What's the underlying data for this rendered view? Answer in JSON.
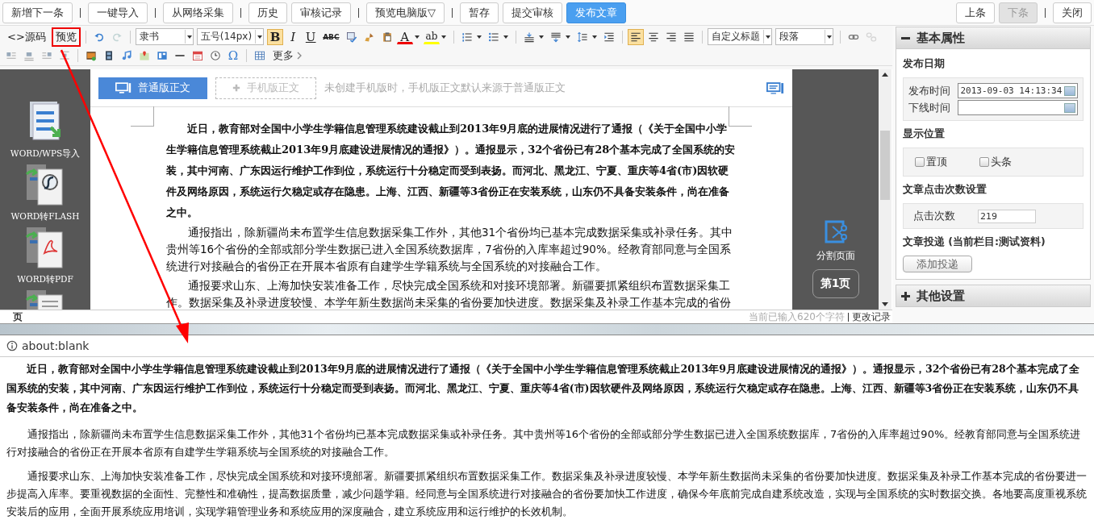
{
  "top_bar": {
    "left": [
      {
        "kind": "button",
        "label": "新增下一条",
        "disabled": false
      },
      {
        "kind": "sep"
      },
      {
        "kind": "button",
        "label": "一键导入",
        "disabled": false
      },
      {
        "kind": "sep"
      },
      {
        "kind": "button",
        "label": "从网络采集",
        "disabled": false
      },
      {
        "kind": "sep"
      },
      {
        "kind": "button",
        "label": "历史",
        "disabled": false
      },
      {
        "kind": "button",
        "label": "审核记录",
        "disabled": false
      },
      {
        "kind": "sep"
      },
      {
        "kind": "button",
        "label": "预览电脑版▽",
        "disabled": false
      },
      {
        "kind": "sep"
      },
      {
        "kind": "button",
        "label": "暂存",
        "disabled": false
      },
      {
        "kind": "button",
        "label": "提交审核",
        "disabled": false
      },
      {
        "kind": "primary",
        "label": "发布文章",
        "disabled": false
      }
    ],
    "right": [
      {
        "kind": "button",
        "label": "上条",
        "disabled": false
      },
      {
        "kind": "button",
        "label": "下条",
        "disabled": true
      },
      {
        "kind": "sep"
      },
      {
        "kind": "button",
        "label": "关闭",
        "disabled": false
      }
    ]
  },
  "toolbar": {
    "row1": [
      {
        "kind": "text",
        "label": "<>源码",
        "highlighted": false
      },
      {
        "kind": "text",
        "label": "预览",
        "highlighted": true
      },
      {
        "kind": "sep"
      },
      {
        "kind": "undo",
        "disabled": false
      },
      {
        "kind": "redo",
        "disabled": true
      },
      {
        "kind": "sep"
      },
      {
        "kind": "select",
        "value": "隶书"
      },
      {
        "kind": "select",
        "value": "五号(14px)"
      },
      {
        "kind": "bold",
        "label": "B",
        "selected": true
      },
      {
        "kind": "italic",
        "label": "I",
        "selected": false
      },
      {
        "kind": "underline",
        "label": "U",
        "selected": false
      },
      {
        "kind": "strike",
        "label": "ABC",
        "selected": false
      },
      {
        "kind": "spell"
      },
      {
        "kind": "brush"
      },
      {
        "kind": "paste"
      },
      {
        "kind": "fontcolor",
        "label": "A"
      },
      {
        "kind": "highlight",
        "label": "ab"
      },
      {
        "kind": "sep"
      },
      {
        "kind": "olist"
      },
      {
        "kind": "ulist"
      },
      {
        "kind": "sep"
      },
      {
        "kind": "space-top"
      },
      {
        "kind": "space-bottom"
      },
      {
        "kind": "line-height"
      },
      {
        "kind": "indent"
      },
      {
        "kind": "sep"
      },
      {
        "kind": "align-left",
        "selected": true
      },
      {
        "kind": "align-center",
        "selected": false
      },
      {
        "kind": "align-right",
        "selected": false
      },
      {
        "kind": "justify",
        "selected": false
      },
      {
        "kind": "sep"
      },
      {
        "kind": "select",
        "value": "自定义标题"
      },
      {
        "kind": "select",
        "value": "段落"
      },
      {
        "kind": "sep"
      },
      {
        "kind": "link",
        "disabled": false
      },
      {
        "kind": "unlink",
        "disabled": true
      }
    ],
    "row2": [
      {
        "kind": "float-left"
      },
      {
        "kind": "float-none"
      },
      {
        "kind": "float-right"
      },
      {
        "kind": "float-center"
      },
      {
        "kind": "sep"
      },
      {
        "kind": "image"
      },
      {
        "kind": "video"
      },
      {
        "kind": "music"
      },
      {
        "kind": "map"
      },
      {
        "kind": "template"
      },
      {
        "kind": "hr"
      },
      {
        "kind": "date"
      },
      {
        "kind": "time"
      },
      {
        "kind": "symbol",
        "label": "Ω"
      },
      {
        "kind": "sep"
      },
      {
        "kind": "table"
      },
      {
        "kind": "more",
        "label": "更多"
      }
    ]
  },
  "tools_panel": [
    {
      "kind": "wps",
      "label": "WORD/WPS导入"
    },
    {
      "kind": "flash",
      "label": "WORD转FLASH"
    },
    {
      "kind": "pdf",
      "label": "WORD转PDF"
    },
    {
      "kind": "doc"
    }
  ],
  "editor_tabs": [
    {
      "label": "普通版正文",
      "selected": true
    },
    {
      "label": "手机版正文",
      "selected": false
    }
  ],
  "editor_hint": "未创建手机版时，手机版正文默认来源于普通版正文",
  "content": [
    {
      "kind": "lishu",
      "text": "近日，教育部对全国中小学生学籍信息管理系统建设截止到2013年9月底的进展情况进行了通报（《关于全国中小学生学籍信息管理系统截止2013年9月底建设进展情况的通报》）。通报显示，32个省份已有28个基本完成了全国系统的安装，其中河南、广东因运行维护工作到位，系统运行十分稳定而受到表扬。而河北、黑龙江、宁夏、重庆等4省(市)因软硬件及网络原因，系统运行欠稳定或存在隐患。上海、江西、新疆等3省份正在安装系统，山东仍不具备安装条件，尚在准备之中。"
    },
    {
      "kind": "plain",
      "text": "通报指出，除新疆尚未布置学生信息数据采集工作外，其他31个省份均已基本完成数据采集或补录任务。其中贵州等16个省份的全部或部分学生数据已进入全国系统数据库，7省份的入库率超过90%。经教育部同意与全国系统进行对接融合的省份正在开展本省原有自建学生学籍系统与全国系统的对接融合工作。"
    },
    {
      "kind": "plain",
      "text": "通报要求山东、上海加快安装准备工作，尽快完成全国系统和对接环境部署。新疆要抓紧组织布置数据采集工作。数据采集及补录进度较慢、本学年新生数据尚未采集的省份要加快进度。数据采集及补录工作基本完成的省份"
    }
  ],
  "page_tools": {
    "split_label": "分割页面",
    "page_button": "第1页"
  },
  "status_bar": {
    "left": "页",
    "count": "当前已输入620个字符",
    "history_link": "更改记录"
  },
  "side_panel": [
    {
      "title": "基本属性",
      "expanded": true
    },
    {
      "title": "其他设置",
      "expanded": false
    }
  ],
  "basic": {
    "date_heading": "发布日期",
    "publish_label": "发布时间",
    "publish_value": "2013-09-03 14:13:34",
    "offline_label": "下线时间",
    "position_heading": "显示位置",
    "positions": [
      {
        "label": "置顶",
        "checked": false
      },
      {
        "label": "头条",
        "checked": false
      }
    ],
    "clicks_heading": "文章点击次数设置",
    "clicks_label": "点击次数",
    "clicks_value": "219",
    "delivery_heading": "文章投递 (当前栏目:测试资料)",
    "delivery_button": "添加投递"
  },
  "preview_window": {
    "address": "about:blank",
    "paragraphs": [
      {
        "kind": "lishu",
        "text": "近日，教育部对全国中小学生学籍信息管理系统建设截止到2013年9月底的进展情况进行了通报（《关于全国中小学生学籍信息管理系统截止2013年9月底建设进展情况的通报》）。通报显示，32个省份已有28个基本完成了全国系统的安装，其中河南、广东因运行维护工作到位，系统运行十分稳定而受到表扬。而河北、黑龙江、宁夏、重庆等4省(市)因软硬件及网络原因，系统运行欠稳定或存在隐患。上海、江西、新疆等3省份正在安装系统，山东仍不具备安装条件，尚在准备之中。"
      },
      {
        "kind": "plain",
        "text": "通报指出，除新疆尚未布置学生信息数据采集工作外，其他31个省份均已基本完成数据采集或补录任务。其中贵州等16个省份的全部或部分学生数据已进入全国系统数据库，7省份的入库率超过90%。经教育部同意与全国系统进行对接融合的省份正在开展本省原有自建学生学籍系统与全国系统的对接融合工作。"
      },
      {
        "kind": "plain",
        "text": "通报要求山东、上海加快安装准备工作，尽快完成全国系统和对接环境部署。新疆要抓紧组织布置数据采集工作。数据采集及补录进度较慢、本学年新生数据尚未采集的省份要加快进度。数据采集及补录工作基本完成的省份要进一步提高入库率。要重视数据的全面性、完整性和准确性，提高数据质量，减少问题学籍。经同意与全国系统进行对接融合的省份要加快工作进度，确保今年底前完成自建系统改造，实现与全国系统的实时数据交换。各地要高度重视系统安装后的应用，全面开展系统应用培训，实现学籍管理业务和系统应用的深度融合，建立系统应用和运行维护的长效机制。"
      }
    ]
  }
}
